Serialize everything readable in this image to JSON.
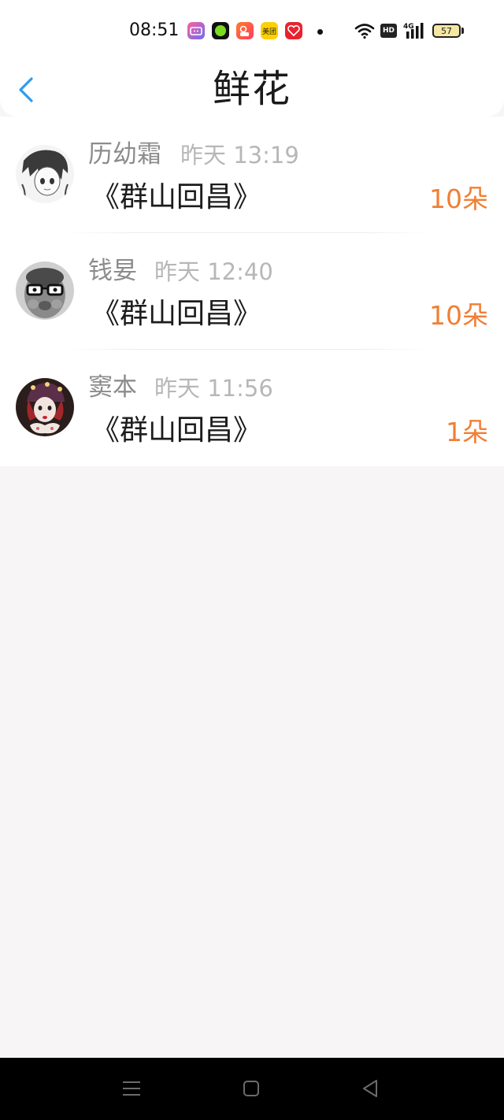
{
  "status_bar": {
    "time": "08:51",
    "battery": "57",
    "network": "4G",
    "hd": "HD",
    "app_icons": [
      "bilibili-icon",
      "green-app-icon",
      "video-app-icon",
      "meituan-icon",
      "red-app-icon"
    ],
    "meituan_label": "美团"
  },
  "header": {
    "title": "鲜花"
  },
  "gifts": [
    {
      "name": "历幼霜",
      "time": "昨天 13:19",
      "book": "《群山回昌》",
      "count": "10朵"
    },
    {
      "name": "钱妟",
      "time": "昨天 12:40",
      "book": "《群山回昌》",
      "count": "10朵"
    },
    {
      "name": "窦本",
      "time": "昨天 11:56",
      "book": "《群山回昌》",
      "count": "1朵"
    }
  ],
  "colors": {
    "accent": "#2d9cf0",
    "count": "#f07f35",
    "background": "#f7f5f6"
  }
}
